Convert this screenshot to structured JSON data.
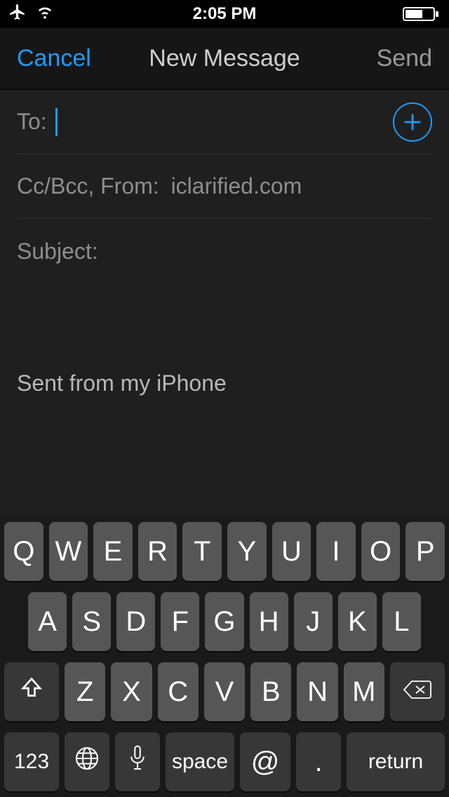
{
  "status": {
    "time": "2:05 PM"
  },
  "nav": {
    "cancel": "Cancel",
    "title": "New Message",
    "send": "Send"
  },
  "fields": {
    "to_label": "To:",
    "ccbcc_label": "Cc/Bcc, From:",
    "from_value": "iclarified.com",
    "subject_label": "Subject:"
  },
  "body": {
    "signature": "Sent from my iPhone"
  },
  "keyboard": {
    "row1": [
      "Q",
      "W",
      "E",
      "R",
      "T",
      "Y",
      "U",
      "I",
      "O",
      "P"
    ],
    "row2": [
      "A",
      "S",
      "D",
      "F",
      "G",
      "H",
      "J",
      "K",
      "L"
    ],
    "row3": [
      "Z",
      "X",
      "C",
      "V",
      "B",
      "N",
      "M"
    ],
    "k123": "123",
    "space": "space",
    "at": "@",
    "dot": ".",
    "return": "return"
  }
}
